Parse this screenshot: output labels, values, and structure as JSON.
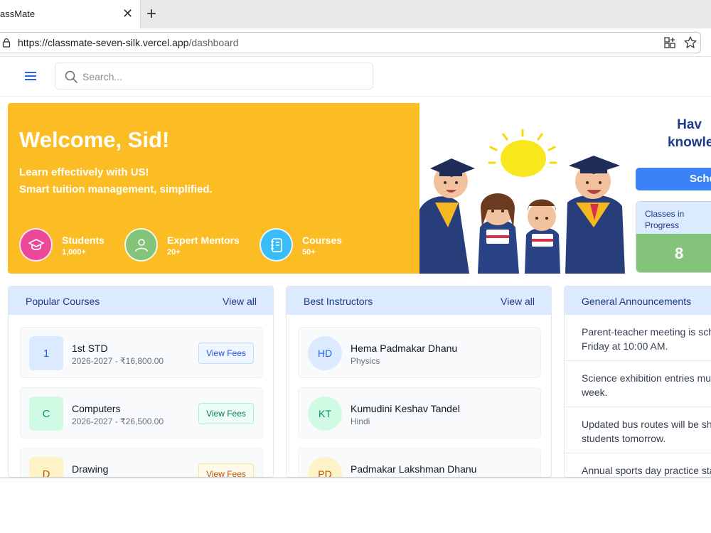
{
  "browser": {
    "tab_title": "assMate",
    "url_host": "https://classmate-seven-silk.vercel.app",
    "url_path": "/dashboard"
  },
  "search": {
    "placeholder": "Search..."
  },
  "hero": {
    "welcome": "Welcome, Sid!",
    "tagline1": "Learn effectively with US!",
    "tagline2": "Smart tuition management, simplified.",
    "stats": [
      {
        "label": "Students",
        "value": "1,000+",
        "color": "#ec4899",
        "icon": "graduation-cap-icon"
      },
      {
        "label": "Expert Mentors",
        "value": "20+",
        "color": "#84c47a",
        "icon": "user-icon"
      },
      {
        "label": "Courses",
        "value": "50+",
        "color": "#38bdf8",
        "icon": "notebook-icon"
      }
    ]
  },
  "promo": {
    "line1": "Hav",
    "line2": "knowled",
    "button": "Sche",
    "classes_label": "Classes in Progress",
    "classes_value": "8"
  },
  "popular_courses": {
    "title": "Popular Courses",
    "view_all": "View all",
    "button_label": "View Fees",
    "items": [
      {
        "badge": "1",
        "name": "1st STD",
        "meta": "2026-2027 - ₹16,800.00",
        "bg": "#dbeafe",
        "fg": "#2563eb"
      },
      {
        "badge": "C",
        "name": "Computers",
        "meta": "2026-2027 - ₹26,500.00",
        "bg": "#d1fae5",
        "fg": "#059669"
      },
      {
        "badge": "D",
        "name": "Drawing",
        "meta": "",
        "bg": "#fef3c7",
        "fg": "#b45309"
      }
    ]
  },
  "instructors": {
    "title": "Best Instructors",
    "view_all": "View all",
    "items": [
      {
        "initials": "HD",
        "name": "Hema Padmakar Dhanu",
        "subject": "Physics",
        "bg": "#dbeafe",
        "fg": "#2563eb"
      },
      {
        "initials": "KT",
        "name": "Kumudini Keshav Tandel",
        "subject": "Hindi",
        "bg": "#d1fae5",
        "fg": "#059669"
      },
      {
        "initials": "PD",
        "name": "Padmakar Lakshman Dhanu",
        "subject": "",
        "bg": "#fef3c7",
        "fg": "#b45309"
      }
    ]
  },
  "announcements": {
    "title": "General Announcements",
    "items": [
      "Parent-teacher meeting is sch\nFriday at 10:00 AM.",
      "Science exhibition entries mus\nweek.",
      "Updated bus routes will be sh\nstudents tomorrow.",
      "Annual sports day practice sta"
    ]
  }
}
